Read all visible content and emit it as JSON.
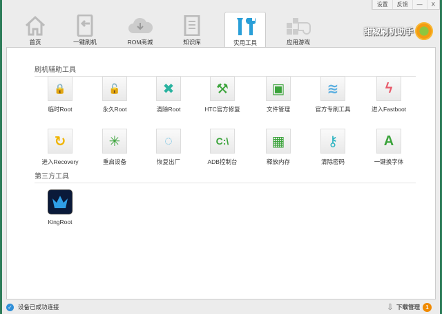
{
  "window_controls": {
    "settings": "设置",
    "feedback": "反馈",
    "minimize": "—",
    "close": "X"
  },
  "tabs": [
    {
      "label": "首页"
    },
    {
      "label": "一键刷机"
    },
    {
      "label": "ROM商城"
    },
    {
      "label": "知识库"
    },
    {
      "label": "实用工具"
    },
    {
      "label": "应用游戏"
    }
  ],
  "brand": "甜椒刷机助手",
  "sections": {
    "flash_tools": "刷机辅助工具",
    "third_party": "第三方工具"
  },
  "tools": [
    {
      "label": "临时Root",
      "glyph": "🔒",
      "color": "#f0b400"
    },
    {
      "label": "永久Root",
      "glyph": "🔓",
      "color": "#e8862a"
    },
    {
      "label": "清除Root",
      "glyph": "✖",
      "color": "#2bb3a0"
    },
    {
      "label": "HTC官方修复",
      "glyph": "⚒",
      "color": "#3aa33a"
    },
    {
      "label": "文件管理",
      "glyph": "▣",
      "color": "#3aa33a"
    },
    {
      "label": "官方专刷工具",
      "glyph": "≋",
      "color": "#5aaee0"
    },
    {
      "label": "进入Fastboot",
      "glyph": "ϟ",
      "color": "#e85a6a"
    },
    {
      "label": "进入Recovery",
      "glyph": "↻",
      "color": "#f0b400"
    },
    {
      "label": "重启设备",
      "glyph": "✳",
      "color": "#3aa33a"
    },
    {
      "label": "恢复出厂",
      "glyph": "◌",
      "color": "#5ab8e0"
    },
    {
      "label": "ADB控制台",
      "glyph": "C:\\",
      "color": "#3aa33a"
    },
    {
      "label": "释放内存",
      "glyph": "▦",
      "color": "#3aa33a"
    },
    {
      "label": "清除密码",
      "glyph": "⚷",
      "color": "#2bb3c0"
    },
    {
      "label": "一键换字体",
      "glyph": "A",
      "color": "#3aa33a"
    }
  ],
  "third_party_tools": [
    {
      "label": "KingRoot"
    }
  ],
  "status": {
    "text": "设备已成功连接",
    "download": "下载管理",
    "download_count": "1"
  }
}
